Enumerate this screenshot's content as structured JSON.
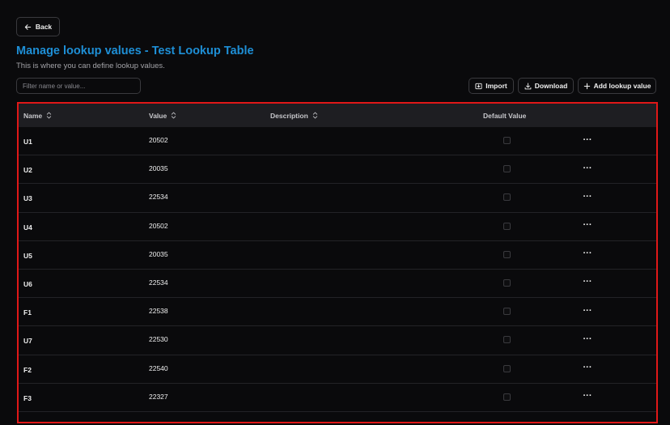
{
  "header": {
    "back_label": "Back",
    "title": "Manage lookup values - Test Lookup Table",
    "subtitle": "This is where you can define lookup values."
  },
  "toolbar": {
    "filter_placeholder": "Filter name or value...",
    "filter_value": "",
    "import_label": "Import",
    "download_label": "Download",
    "add_label": "Add lookup value"
  },
  "table": {
    "columns": {
      "name": "Name",
      "value": "Value",
      "description": "Description",
      "default_value": "Default Value"
    },
    "rows": [
      {
        "name": "U1",
        "value": "20502",
        "description": "",
        "default": false,
        "actions": "···"
      },
      {
        "name": "U2",
        "value": "20035",
        "description": "",
        "default": false,
        "actions": "···"
      },
      {
        "name": "U3",
        "value": "22534",
        "description": "",
        "default": false,
        "actions": "···"
      },
      {
        "name": "U4",
        "value": "20502",
        "description": "",
        "default": false,
        "actions": "···"
      },
      {
        "name": "U5",
        "value": "20035",
        "description": "",
        "default": false,
        "actions": "···"
      },
      {
        "name": "U6",
        "value": "22534",
        "description": "",
        "default": false,
        "actions": "···"
      },
      {
        "name": "F1",
        "value": "22538",
        "description": "",
        "default": false,
        "actions": "···"
      },
      {
        "name": "U7",
        "value": "22530",
        "description": "",
        "default": false,
        "actions": "···"
      },
      {
        "name": "F2",
        "value": "22540",
        "description": "",
        "default": false,
        "actions": "···"
      },
      {
        "name": "F3",
        "value": "22327",
        "description": "",
        "default": false,
        "actions": "···"
      }
    ]
  },
  "colors": {
    "accent": "#1e8fd6",
    "background": "#0a0a0c",
    "header_row": "#1e1e22",
    "highlight_border": "#e01818"
  },
  "icons": {
    "back": "arrow-left-icon",
    "import": "import-icon",
    "download": "download-icon",
    "add": "plus-icon",
    "sort": "sort-icon",
    "more": "more-horizontal-icon"
  }
}
